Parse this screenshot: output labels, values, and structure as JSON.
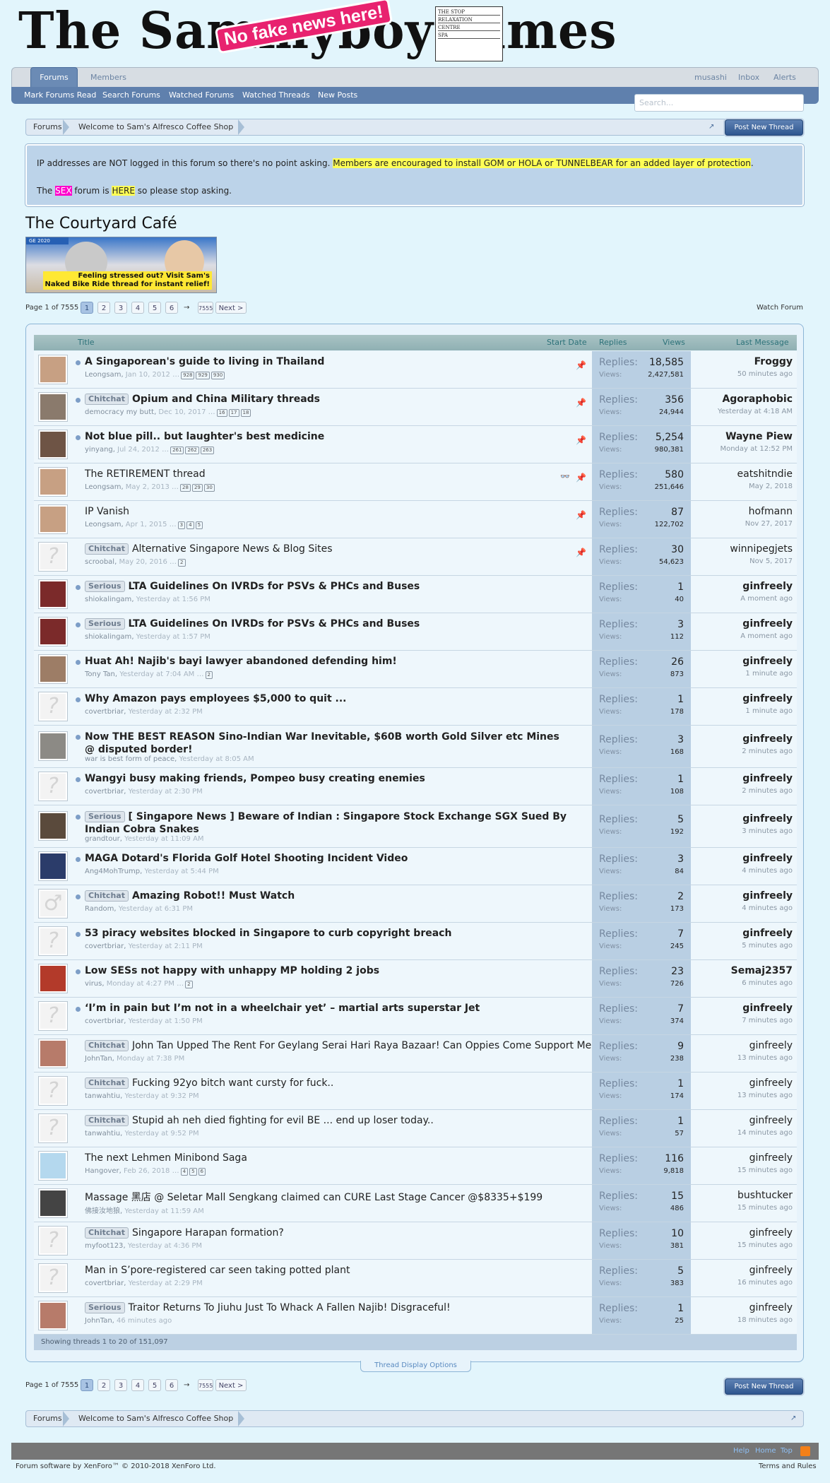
{
  "header": {
    "site_title": "The Sammyboy Times",
    "stamp": "No fake news here!",
    "ad_lines": [
      "THE STOP",
      "RELAXATION",
      "CENTRE",
      "SPA"
    ]
  },
  "nav": {
    "tabs": [
      {
        "label": "Forums"
      },
      {
        "label": "Members"
      }
    ],
    "right": [
      {
        "label": "musashi"
      },
      {
        "label": "Inbox"
      },
      {
        "label": "Alerts"
      }
    ],
    "sub": [
      {
        "label": "Mark Forums Read"
      },
      {
        "label": "Search Forums"
      },
      {
        "label": "Watched Forums"
      },
      {
        "label": "Watched Threads"
      },
      {
        "label": "New Posts"
      }
    ],
    "search_placeholder": "Search..."
  },
  "breadcrumb": {
    "items": [
      {
        "label": "Forums"
      },
      {
        "label": "Welcome to Sam's Alfresco Coffee Shop"
      }
    ]
  },
  "post_new_thread": "Post New Thread",
  "notice": {
    "line1_a": "IP addresses are NOT logged in this forum so there's no point asking.",
    "line1_b": "Members are encouraged to install GOM or HOLA or TUNNELBEAR for an added layer of protection",
    "line1_c": ".",
    "line2_a": "The",
    "line2_b": "SEX",
    "line2_c": "forum is",
    "line2_d": "HERE",
    "line2_e": "so please stop asking."
  },
  "forum_title": "The Courtyard Café",
  "banner": {
    "tag": "GE 2020",
    "caption_1": "Feeling stressed out? Visit Sam's",
    "caption_2": "Naked Bike Ride thread for instant relief!"
  },
  "pagination": {
    "label": "Page 1 of 7555",
    "pages": [
      "1",
      "2",
      "3",
      "4",
      "5",
      "6"
    ],
    "arrow": "→",
    "last": "7555",
    "next": "Next >",
    "watch": "Watch Forum"
  },
  "table": {
    "headers": {
      "title": "Title",
      "start_date": "Start Date",
      "replies": "Replies",
      "views": "Views",
      "last": "Last Message ↓"
    },
    "replies_label": "Replies:",
    "views_label": "Views:",
    "threads": [
      {
        "prefix": "",
        "title": "A Singaporean's guide to living in Thailand",
        "bold": true,
        "author": "Leongsam",
        "date": "Jan 10, 2012",
        "pages": [
          "928",
          "929",
          "930"
        ],
        "sticky": true,
        "replies": "18,585",
        "views": "2,427,581",
        "last_user": "Froggy",
        "last_bold": true,
        "last_time": "50 minutes ago",
        "avatar": "face1",
        "dot": true
      },
      {
        "prefix": "Chitchat",
        "title": "Opium and China Military threads",
        "bold": true,
        "author": "democracy my butt",
        "date": "Dec 10, 2017",
        "pages": [
          "16",
          "17",
          "18"
        ],
        "sticky": true,
        "replies": "356",
        "views": "24,944",
        "last_user": "Agoraphobic",
        "last_bold": true,
        "last_time": "Yesterday at 4:18 AM",
        "avatar": "face2",
        "dot": true
      },
      {
        "prefix": "",
        "title": "Not blue pill.. but laughter's best medicine",
        "bold": true,
        "author": "yinyang",
        "date": "Jul 24, 2012",
        "pages": [
          "261",
          "262",
          "263"
        ],
        "sticky": true,
        "replies": "5,254",
        "views": "980,381",
        "last_user": "Wayne Piew",
        "last_bold": true,
        "last_time": "Monday at 12:52 PM",
        "avatar": "face3",
        "dot": true
      },
      {
        "prefix": "",
        "title": "The RETIREMENT thread",
        "bold": false,
        "author": "Leongsam",
        "date": "May 2, 2013",
        "pages": [
          "28",
          "29",
          "30"
        ],
        "sticky": true,
        "glass": true,
        "replies": "580",
        "views": "251,646",
        "last_user": "eatshitndie",
        "last_bold": false,
        "last_time": "May 2, 2018",
        "avatar": "face1",
        "dot": false
      },
      {
        "prefix": "",
        "title": "IP Vanish",
        "bold": false,
        "author": "Leongsam",
        "date": "Apr 1, 2015",
        "pages": [
          "3",
          "4",
          "5"
        ],
        "sticky": true,
        "replies": "87",
        "views": "122,702",
        "last_user": "hofmann",
        "last_bold": false,
        "last_time": "Nov 27, 2017",
        "avatar": "face1",
        "dot": false
      },
      {
        "prefix": "Chitchat",
        "title": "Alternative Singapore News & Blog Sites",
        "bold": false,
        "author": "scroobal",
        "date": "May 20, 2016",
        "pages": [
          "2"
        ],
        "sticky": true,
        "replies": "30",
        "views": "54,623",
        "last_user": "winnipegjets",
        "last_bold": false,
        "last_time": "Nov 5, 2017",
        "avatar": "none",
        "dot": false
      },
      {
        "prefix": "Serious",
        "title": "LTA Guidelines On IVRDs for PSVs & PHCs and Buses",
        "bold": true,
        "author": "shiokalingam",
        "date": "Yesterday at 1:56 PM",
        "pages": [],
        "sticky": false,
        "replies": "1",
        "views": "40",
        "last_user": "ginfreely",
        "last_bold": true,
        "last_time": "A moment ago",
        "avatar": "seal",
        "dot": true
      },
      {
        "prefix": "Serious",
        "title": "LTA Guidelines On IVRDs for PSVs & PHCs and Buses",
        "bold": true,
        "author": "shiokalingam",
        "date": "Yesterday at 1:57 PM",
        "pages": [],
        "sticky": false,
        "replies": "3",
        "views": "112",
        "last_user": "ginfreely",
        "last_bold": true,
        "last_time": "A moment ago",
        "avatar": "seal",
        "dot": true
      },
      {
        "prefix": "",
        "title": "Huat Ah! Najib's bayi lawyer abandoned defending him!",
        "bold": true,
        "author": "Tony Tan",
        "date": "Yesterday at 7:04 AM",
        "pages": [
          "2"
        ],
        "sticky": false,
        "replies": "26",
        "views": "873",
        "last_user": "ginfreely",
        "last_bold": true,
        "last_time": "1 minute ago",
        "avatar": "face4",
        "dot": true
      },
      {
        "prefix": "",
        "title": "Why Amazon pays employees $5,000 to quit ...",
        "bold": true,
        "author": "covertbriar",
        "date": "Yesterday at 2:32 PM",
        "pages": [],
        "sticky": false,
        "replies": "1",
        "views": "178",
        "last_user": "ginfreely",
        "last_bold": true,
        "last_time": "1 minute ago",
        "avatar": "none",
        "dot": true
      },
      {
        "prefix": "",
        "title": "Now THE BEST REASON Sino-Indian War Inevitable, $60B worth Gold Silver etc Mines @ disputed border!",
        "bold": true,
        "author": "war is best form of peace",
        "date": "Yesterday at 8:05 AM",
        "pages": [],
        "sticky": false,
        "replies": "3",
        "views": "168",
        "last_user": "ginfreely",
        "last_bold": true,
        "last_time": "2 minutes ago",
        "avatar": "face5",
        "dot": true,
        "tall": true
      },
      {
        "prefix": "",
        "title": "Wangyi busy making friends, Pompeo busy creating enemies",
        "bold": true,
        "author": "covertbriar",
        "date": "Yesterday at 2:30 PM",
        "pages": [],
        "sticky": false,
        "replies": "1",
        "views": "108",
        "last_user": "ginfreely",
        "last_bold": true,
        "last_time": "2 minutes ago",
        "avatar": "none",
        "dot": true
      },
      {
        "prefix": "Serious",
        "title": "[ Singapore News ] Beware of Indian : Singapore Stock Exchange SGX Sued By Indian Cobra Snakes",
        "bold": true,
        "author": "grandtour",
        "date": "Yesterday at 11:09 AM",
        "pages": [],
        "sticky": false,
        "replies": "5",
        "views": "192",
        "last_user": "ginfreely",
        "last_bold": true,
        "last_time": "3 minutes ago",
        "avatar": "face6",
        "dot": true,
        "tall": true
      },
      {
        "prefix": "",
        "title": "MAGA Dotard's Florida Golf Hotel Shooting Incident Video",
        "bold": true,
        "author": "Ang4MohTrump",
        "date": "Yesterday at 5:44 PM",
        "pages": [],
        "sticky": false,
        "replies": "3",
        "views": "84",
        "last_user": "ginfreely",
        "last_bold": true,
        "last_time": "4 minutes ago",
        "avatar": "face7",
        "dot": true
      },
      {
        "prefix": "Chitchat",
        "title": "Amazing Robot!! Must Watch",
        "bold": true,
        "author": "Random",
        "date": "Yesterday at 6:31 PM",
        "pages": [],
        "sticky": false,
        "replies": "2",
        "views": "173",
        "last_user": "ginfreely",
        "last_bold": true,
        "last_time": "4 minutes ago",
        "avatar": "male",
        "dot": true
      },
      {
        "prefix": "",
        "title": "53 piracy websites blocked in Singapore to curb copyright breach",
        "bold": true,
        "author": "covertbriar",
        "date": "Yesterday at 2:11 PM",
        "pages": [],
        "sticky": false,
        "replies": "7",
        "views": "245",
        "last_user": "ginfreely",
        "last_bold": true,
        "last_time": "5 minutes ago",
        "avatar": "none",
        "dot": true
      },
      {
        "prefix": "",
        "title": "Low SESs not happy with unhappy MP holding 2 jobs",
        "bold": true,
        "author": "virus",
        "date": "Monday at 4:27 PM",
        "pages": [
          "2"
        ],
        "sticky": false,
        "replies": "23",
        "views": "726",
        "last_user": "Semaj2357",
        "last_bold": true,
        "last_time": "6 minutes ago",
        "avatar": "virus",
        "dot": true
      },
      {
        "prefix": "",
        "title": "‘I’m in pain but I’m not in a wheelchair yet’ – martial arts superstar Jet",
        "bold": true,
        "author": "covertbriar",
        "date": "Yesterday at 1:50 PM",
        "pages": [],
        "sticky": false,
        "replies": "7",
        "views": "374",
        "last_user": "ginfreely",
        "last_bold": true,
        "last_time": "7 minutes ago",
        "avatar": "none",
        "dot": true
      },
      {
        "prefix": "Chitchat",
        "title": "John Tan Upped The Rent For Geylang Serai Hari Raya Bazaar! Can Oppies Come Support Me?",
        "bold": false,
        "author": "JohnTan",
        "date": "Monday at 7:38 PM",
        "pages": [],
        "sticky": false,
        "replies": "9",
        "views": "238",
        "last_user": "ginfreely",
        "last_bold": false,
        "last_time": "13 minutes ago",
        "avatar": "face8",
        "dot": false
      },
      {
        "prefix": "Chitchat",
        "title": "Fucking 92yo bitch want cursty for fuck..",
        "bold": false,
        "author": "tanwahtiu",
        "date": "Yesterday at 9:32 PM",
        "pages": [],
        "sticky": false,
        "replies": "1",
        "views": "174",
        "last_user": "ginfreely",
        "last_bold": false,
        "last_time": "13 minutes ago",
        "avatar": "none",
        "dot": false
      },
      {
        "prefix": "Chitchat",
        "title": "Stupid ah neh died fighting for evil BE ... end up loser today..",
        "bold": false,
        "author": "tanwahtiu",
        "date": "Yesterday at 9:52 PM",
        "pages": [],
        "sticky": false,
        "replies": "1",
        "views": "57",
        "last_user": "ginfreely",
        "last_bold": false,
        "last_time": "14 minutes ago",
        "avatar": "none",
        "dot": false
      },
      {
        "prefix": "",
        "title": "The next Lehmen Minibond Saga",
        "bold": false,
        "author": "Hangover",
        "date": "Feb 26, 2018",
        "pages": [
          "4",
          "5",
          "6"
        ],
        "sticky": false,
        "replies": "116",
        "views": "9,818",
        "last_user": "ginfreely",
        "last_bold": false,
        "last_time": "15 minutes ago",
        "avatar": "cartoon",
        "dot": false
      },
      {
        "prefix": "",
        "title": "Massage 黑店 @ Seletar Mall Sengkang claimed can CURE Last Stage Cancer @$8335+$199",
        "bold": false,
        "author": "佛接汝地狼",
        "date": "Yesterday at 11:59 AM",
        "pages": [],
        "sticky": false,
        "replies": "15",
        "views": "486",
        "last_user": "bushtucker",
        "last_bold": false,
        "last_time": "15 minutes ago",
        "avatar": "apple",
        "dot": false
      },
      {
        "prefix": "Chitchat",
        "title": "Singapore Harapan formation?",
        "bold": false,
        "author": "myfoot123",
        "date": "Yesterday at 4:36 PM",
        "pages": [],
        "sticky": false,
        "replies": "10",
        "views": "381",
        "last_user": "ginfreely",
        "last_bold": false,
        "last_time": "15 minutes ago",
        "avatar": "none",
        "dot": false
      },
      {
        "prefix": "",
        "title": "Man in S’pore-registered car seen taking potted plant",
        "bold": false,
        "author": "covertbriar",
        "date": "Yesterday at 2:29 PM",
        "pages": [],
        "sticky": false,
        "replies": "5",
        "views": "383",
        "last_user": "ginfreely",
        "last_bold": false,
        "last_time": "16 minutes ago",
        "avatar": "none",
        "dot": false
      },
      {
        "prefix": "Serious",
        "title": "Traitor Returns To Jiuhu Just To Whack A Fallen Najib! Disgraceful!",
        "bold": false,
        "author": "JohnTan",
        "date": "46 minutes ago",
        "pages": [],
        "sticky": false,
        "replies": "1",
        "views": "25",
        "last_user": "ginfreely",
        "last_bold": false,
        "last_time": "18 minutes ago",
        "avatar": "face8",
        "dot": false
      }
    ],
    "showing": "Showing threads 1 to 20 of 151,097"
  },
  "thread_display_options": "Thread Display Options",
  "footer": {
    "links": [
      {
        "label": "Help"
      },
      {
        "label": "Home"
      },
      {
        "label": "Top"
      }
    ],
    "copyright": "Forum software by XenForo™ © 2010-2018 XenForo Ltd.",
    "terms": "Terms and Rules"
  },
  "colors": {
    "accent": "#5f80ad",
    "background": "#e2f5fc",
    "stats_bg": "#b9cfe3"
  }
}
